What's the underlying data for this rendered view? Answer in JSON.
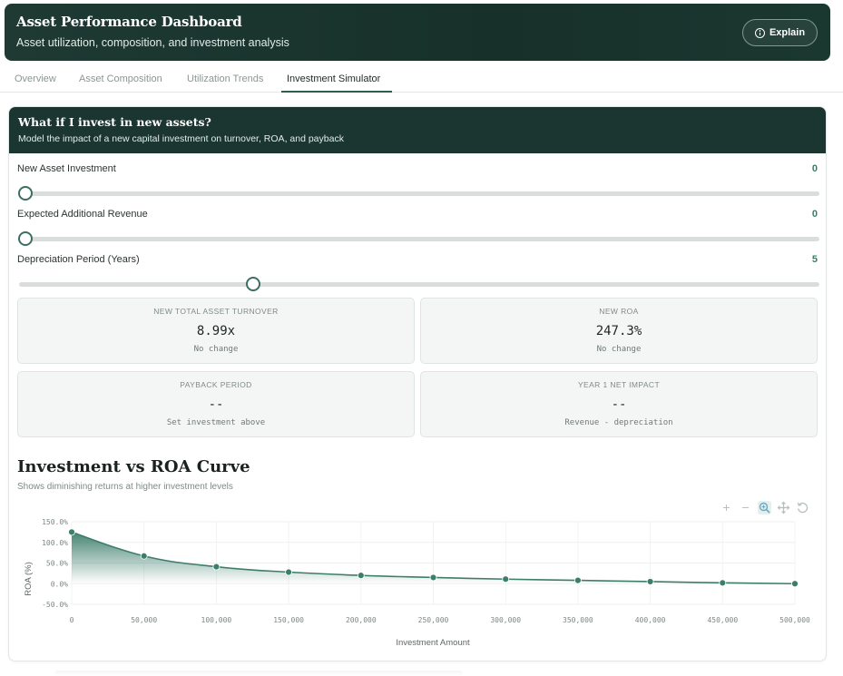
{
  "header": {
    "title": "Asset Performance Dashboard",
    "subtitle": "Asset utilization, composition, and investment analysis",
    "explain_label": "Explain"
  },
  "tabs": [
    {
      "label": "Overview"
    },
    {
      "label": "Asset Composition"
    },
    {
      "label": "Utilization Trends"
    },
    {
      "label": "Investment Simulator",
      "active": true
    }
  ],
  "simulator": {
    "title": "What if I invest in new assets?",
    "subtitle": "Model the impact of a new capital investment on turnover, ROA, and payback",
    "sliders": [
      {
        "label": "New Asset Investment",
        "value": "0",
        "fraction": 0.0
      },
      {
        "label": "Expected Additional Revenue",
        "value": "0",
        "fraction": 0.0
      },
      {
        "label": "Depreciation Period (Years)",
        "value": "5",
        "fraction": 0.2894
      }
    ],
    "metrics": [
      {
        "label": "NEW TOTAL ASSET TURNOVER",
        "value": "8.99x",
        "sub": "No change"
      },
      {
        "label": "NEW ROA",
        "value": "247.3%",
        "sub": "No change"
      },
      {
        "label": "PAYBACK PERIOD",
        "value": "--",
        "sub": "Set investment above"
      },
      {
        "label": "YEAR 1 NET IMPACT",
        "value": "--",
        "sub": "Revenue - depreciation"
      }
    ]
  },
  "chart_title": "Investment vs ROA Curve",
  "chart_subtitle": "Shows diminishing returns at higher investment levels",
  "chart_data": {
    "type": "area",
    "x": [
      0,
      50000,
      100000,
      150000,
      200000,
      250000,
      300000,
      350000,
      400000,
      450000,
      500000
    ],
    "values": [
      125,
      67,
      41,
      28,
      20,
      15,
      11,
      8,
      5,
      2,
      0
    ],
    "xlabel": "Investment Amount",
    "ylabel": "ROA (%)",
    "ylim": [
      -50,
      150
    ],
    "xlim": [
      0,
      500000
    ],
    "y_ticks": [
      150,
      100,
      50,
      0,
      -50
    ],
    "y_tick_labels": [
      "150.0%",
      "100.0%",
      "50.0%",
      "0.0%",
      "-50.0%"
    ],
    "x_tick_labels": [
      "0",
      "50,000",
      "100,000",
      "150,000",
      "200,000",
      "250,000",
      "300,000",
      "350,000",
      "400,000",
      "450,000",
      "500,000"
    ],
    "line_color": "#3d7d6b",
    "grid": true
  },
  "colors": {
    "header_bg": "#1e3a33",
    "accent": "#3d7d6b"
  }
}
